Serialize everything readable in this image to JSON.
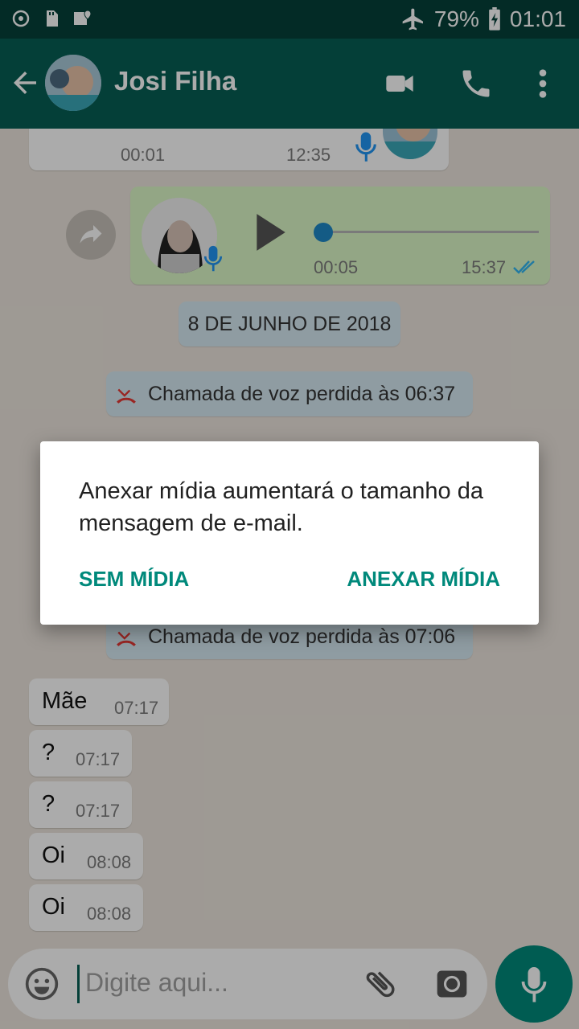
{
  "status_bar": {
    "battery": "79%",
    "time": "01:01",
    "icons": [
      "sync-icon",
      "sd-card-icon",
      "location-icon",
      "airplane-icon",
      "battery-charging-icon"
    ]
  },
  "header": {
    "contact_name": "Josi Filha",
    "icons": [
      "back-arrow-icon",
      "video-call-icon",
      "phone-icon",
      "more-vert-icon"
    ]
  },
  "messages": {
    "voice_top": {
      "duration": "00:01",
      "time": "12:35"
    },
    "voice_out": {
      "duration": "00:05",
      "time": "15:37"
    },
    "date_divider": "8 DE JUNHO DE 2018",
    "missed_call_1": "Chamada de voz perdida às 06:37",
    "missed_call_2": "Chamada de voz perdida às 07:06",
    "items": [
      {
        "text": "Mãe",
        "time": "07:17"
      },
      {
        "text": "?",
        "time": "07:17"
      },
      {
        "text": "?",
        "time": "07:17"
      },
      {
        "text": "Oi",
        "time": "08:08"
      },
      {
        "text": "Oi",
        "time": "08:08"
      }
    ]
  },
  "input": {
    "placeholder": "Digite aqui..."
  },
  "dialog": {
    "message": "Anexar mídia aumentará o tamanho da mensagem de e-mail.",
    "negative_button": "SEM MÍDIA",
    "positive_button": "ANEXAR MÍDIA"
  },
  "colors": {
    "header_bg": "#075e54",
    "status_bg": "#05413a",
    "accent": "#00897b",
    "outgoing_bubble": "#dcf8c6",
    "missed_call_red": "#e53935",
    "tick_blue": "#34b7f1"
  }
}
